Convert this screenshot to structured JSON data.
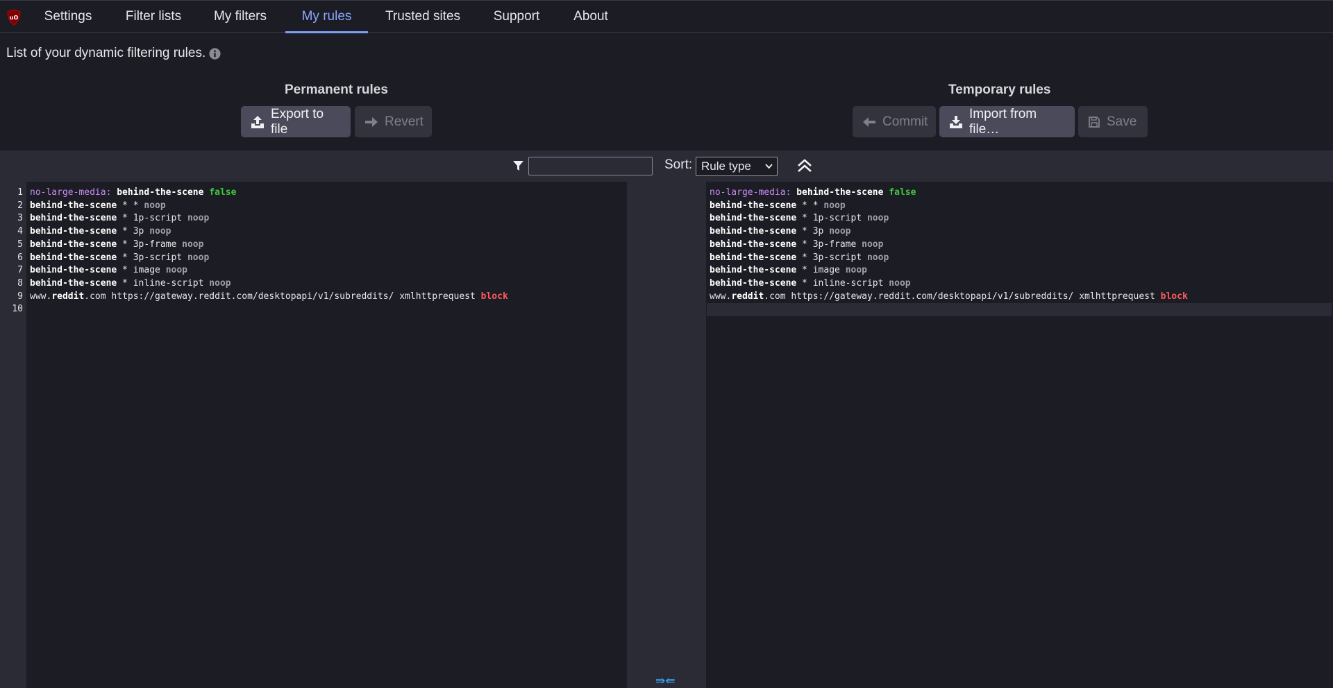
{
  "nav": {
    "tabs": [
      {
        "label": "Settings"
      },
      {
        "label": "Filter lists"
      },
      {
        "label": "My filters"
      },
      {
        "label": "My rules"
      },
      {
        "label": "Trusted sites"
      },
      {
        "label": "Support"
      },
      {
        "label": "About"
      }
    ],
    "active_tab": "My rules"
  },
  "intro": {
    "text": "List of your dynamic filtering rules."
  },
  "permanent": {
    "title": "Permanent rules",
    "export_label": "Export to file",
    "revert_label": "Revert"
  },
  "temporary": {
    "title": "Temporary rules",
    "commit_label": "Commit",
    "import_label": "Import from file…",
    "save_label": "Save"
  },
  "filterbar": {
    "filter_value": "",
    "sort_label": "Sort:",
    "sort_value": "Rule type"
  },
  "rules": [
    [
      {
        "t": "no-large-media:",
        "c": "purple"
      },
      {
        "t": " "
      },
      {
        "t": "behind-the-scene",
        "c": "bold"
      },
      {
        "t": " "
      },
      {
        "t": "false",
        "c": "green"
      }
    ],
    [
      {
        "t": "behind-the-scene",
        "c": "bold"
      },
      {
        "t": " * * "
      },
      {
        "t": "noop",
        "c": "gray"
      }
    ],
    [
      {
        "t": "behind-the-scene",
        "c": "bold"
      },
      {
        "t": " * 1p-script "
      },
      {
        "t": "noop",
        "c": "gray"
      }
    ],
    [
      {
        "t": "behind-the-scene",
        "c": "bold"
      },
      {
        "t": " * 3p "
      },
      {
        "t": "noop",
        "c": "gray"
      }
    ],
    [
      {
        "t": "behind-the-scene",
        "c": "bold"
      },
      {
        "t": " * 3p-frame "
      },
      {
        "t": "noop",
        "c": "gray"
      }
    ],
    [
      {
        "t": "behind-the-scene",
        "c": "bold"
      },
      {
        "t": " * 3p-script "
      },
      {
        "t": "noop",
        "c": "gray"
      }
    ],
    [
      {
        "t": "behind-the-scene",
        "c": "bold"
      },
      {
        "t": " * image "
      },
      {
        "t": "noop",
        "c": "gray"
      }
    ],
    [
      {
        "t": "behind-the-scene",
        "c": "bold"
      },
      {
        "t": " * inline-script "
      },
      {
        "t": "noop",
        "c": "gray"
      }
    ],
    [
      {
        "t": "www."
      },
      {
        "t": "reddit",
        "c": "bold"
      },
      {
        "t": ".com https://gateway.reddit.com/desktopapi/v1/subreddits/ xmlhttprequest "
      },
      {
        "t": "block",
        "c": "red"
      }
    ],
    []
  ],
  "line_numbers": [
    "1",
    "2",
    "3",
    "4",
    "5",
    "6",
    "7",
    "8",
    "9",
    "10"
  ],
  "merge_arrows": "⇛⇚"
}
